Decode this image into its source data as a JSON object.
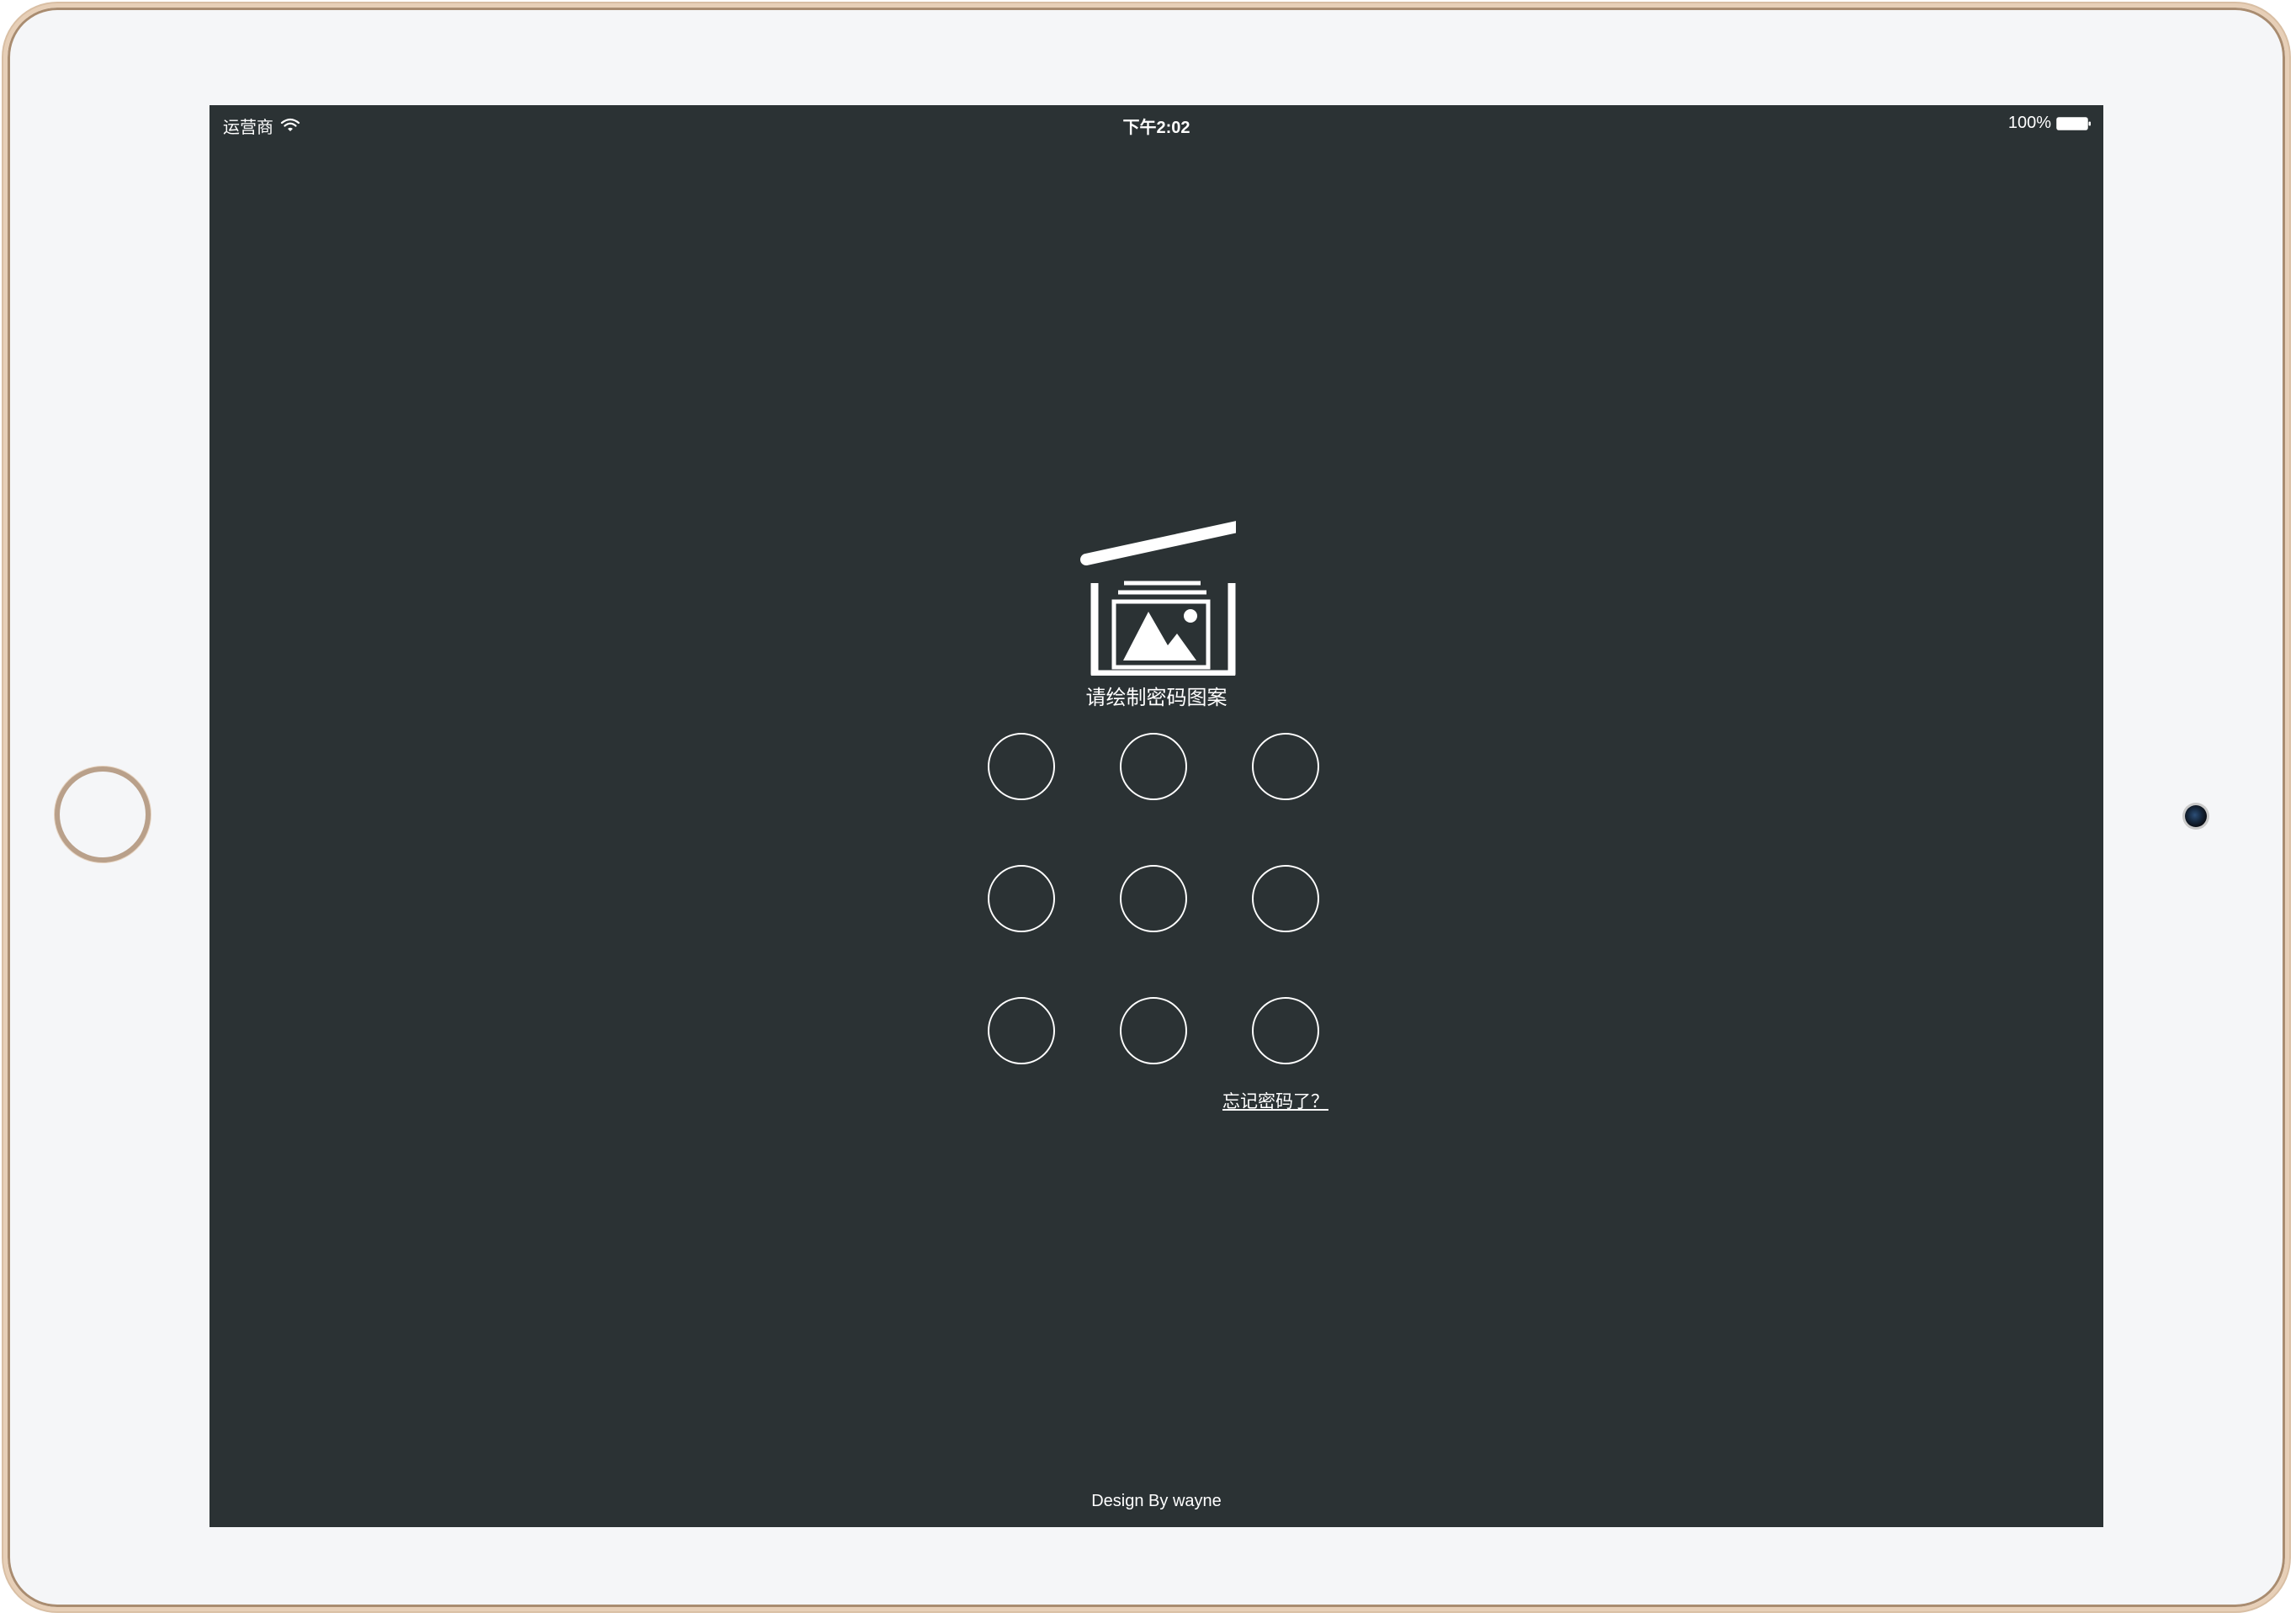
{
  "status_bar": {
    "carrier": "运营商",
    "wifi_icon": "wifi-icon",
    "time": "下午2:02",
    "battery_percent": "100%",
    "battery_icon": "battery-full-icon"
  },
  "app": {
    "logo_icon": "photo-album-icon",
    "prompt": "请绘制密码图案",
    "forgot_password": "忘记密码了？",
    "footer": "Design By wayne"
  },
  "pattern": {
    "rows": 3,
    "cols": 3,
    "selected": []
  },
  "colors": {
    "background": "#2b3234",
    "foreground": "#ffffff",
    "device_bezel": "#f5f6f8",
    "device_frame": "#e7cfb7"
  }
}
